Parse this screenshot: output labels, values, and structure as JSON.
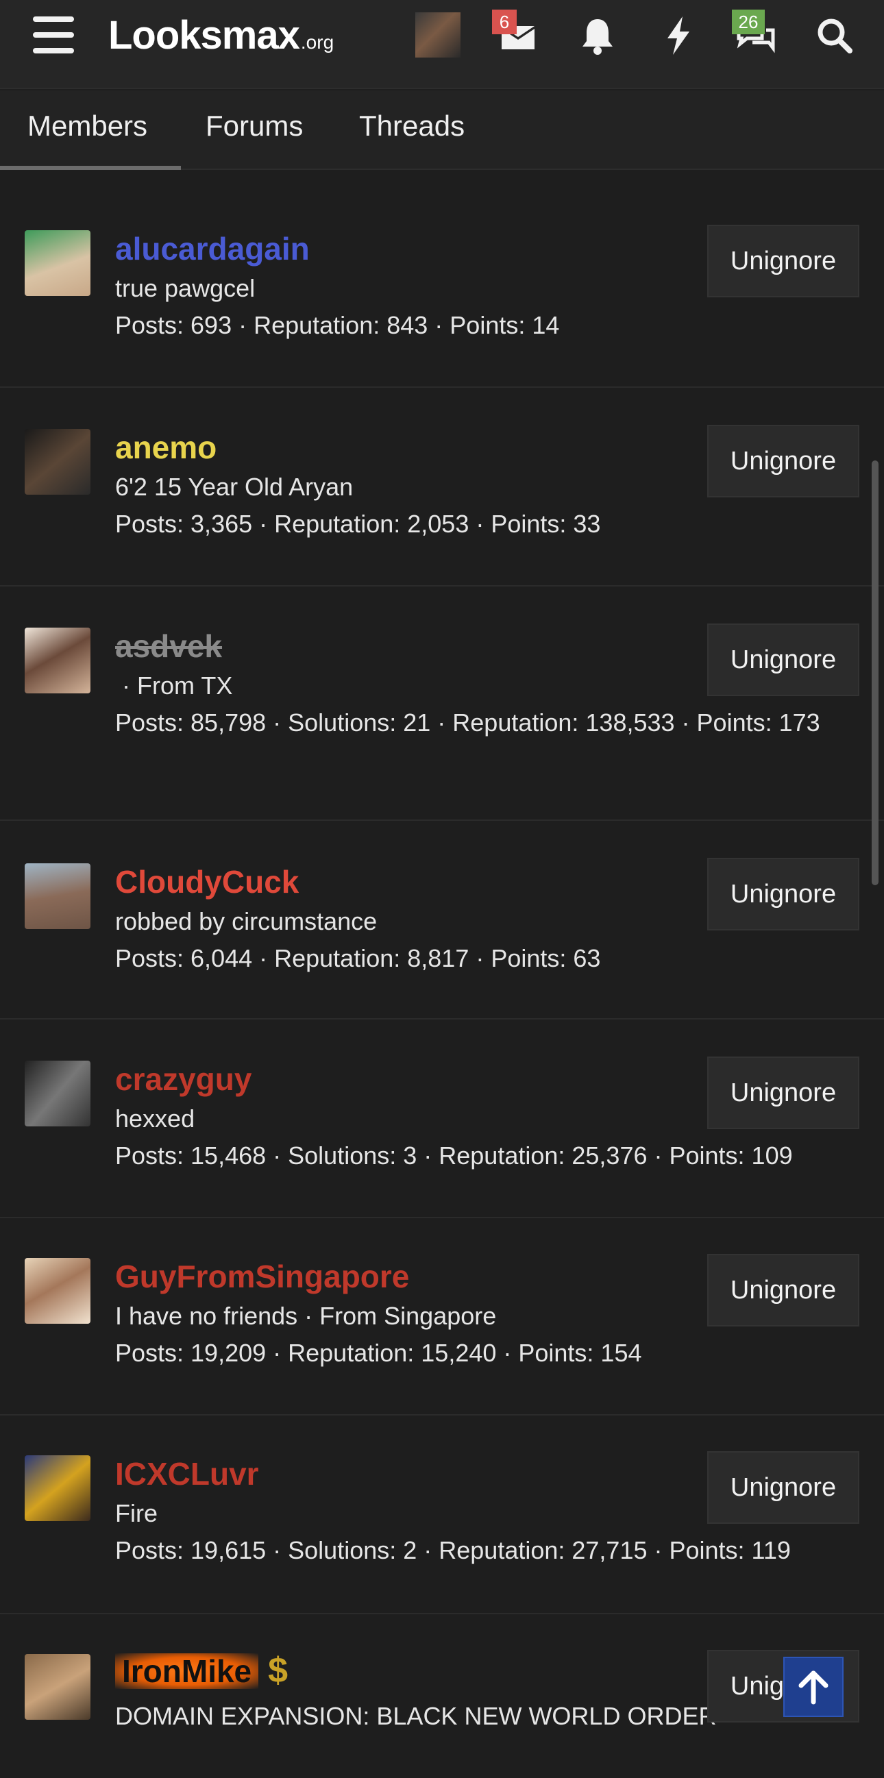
{
  "header": {
    "logo_main": "Looksmax",
    "logo_suffix": ".org",
    "inbox_count": "6",
    "conversations_count": "26",
    "icons": [
      "menu-icon",
      "inbox-icon",
      "bell-icon",
      "bolt-icon",
      "chat-icon",
      "search-icon"
    ]
  },
  "tabs": [
    {
      "label": "Members",
      "active": true
    },
    {
      "label": "Forums",
      "active": false
    },
    {
      "label": "Threads",
      "active": false
    }
  ],
  "button_label": "Unignore",
  "members": [
    {
      "name": "alucardagain",
      "color": "#4a5bd4",
      "title": "true pawgcel",
      "stats": "Posts: 693 · Reputation: 843 · Points: 14",
      "strike": false
    },
    {
      "name": "anemo",
      "color": "#e8d44d",
      "title": "6'2 15 Year Old Aryan",
      "stats": "Posts: 3,365 · Reputation: 2,053 · Points: 33",
      "strike": false
    },
    {
      "name": "asdvek",
      "color": "#8a8a8a",
      "title": " · From TX",
      "stats": "Posts: 85,798 · Solutions: 21 · Reputation: 138,533 · Points: 173",
      "strike": true
    },
    {
      "name": "CloudyCuck",
      "color": "#e0493a",
      "title": "robbed by circumstance",
      "stats": "Posts: 6,044 · Reputation: 8,817 · Points: 63",
      "strike": false
    },
    {
      "name": "crazyguy",
      "color": "#c0392b",
      "title": "hexxed",
      "stats": "Posts: 15,468 · Solutions: 3 · Reputation: 25,376 · Points: 109",
      "strike": false
    },
    {
      "name": "GuyFromSingapore",
      "color": "#c0392b",
      "title": "I have no friends · From Singapore",
      "stats": "Posts: 19,209 · Reputation: 15,240 · Points: 154",
      "strike": false
    },
    {
      "name": "ICXCLuvr",
      "color": "#c0392b",
      "title": "Fire",
      "stats": "Posts: 19,615 · Solutions: 2 · Reputation: 27,715 · Points: 119",
      "strike": false
    },
    {
      "name": "IronMike",
      "color": "#111111",
      "title": "DOMAIN EXPANSION: BLACK NEW WORLD ORDER",
      "stats": "",
      "strike": false,
      "badge": "$"
    }
  ],
  "colors": {
    "background": "#1e1e1e",
    "header": "#262626",
    "button": "#2b2b2b",
    "back_to_top": "#1f3f8f"
  }
}
